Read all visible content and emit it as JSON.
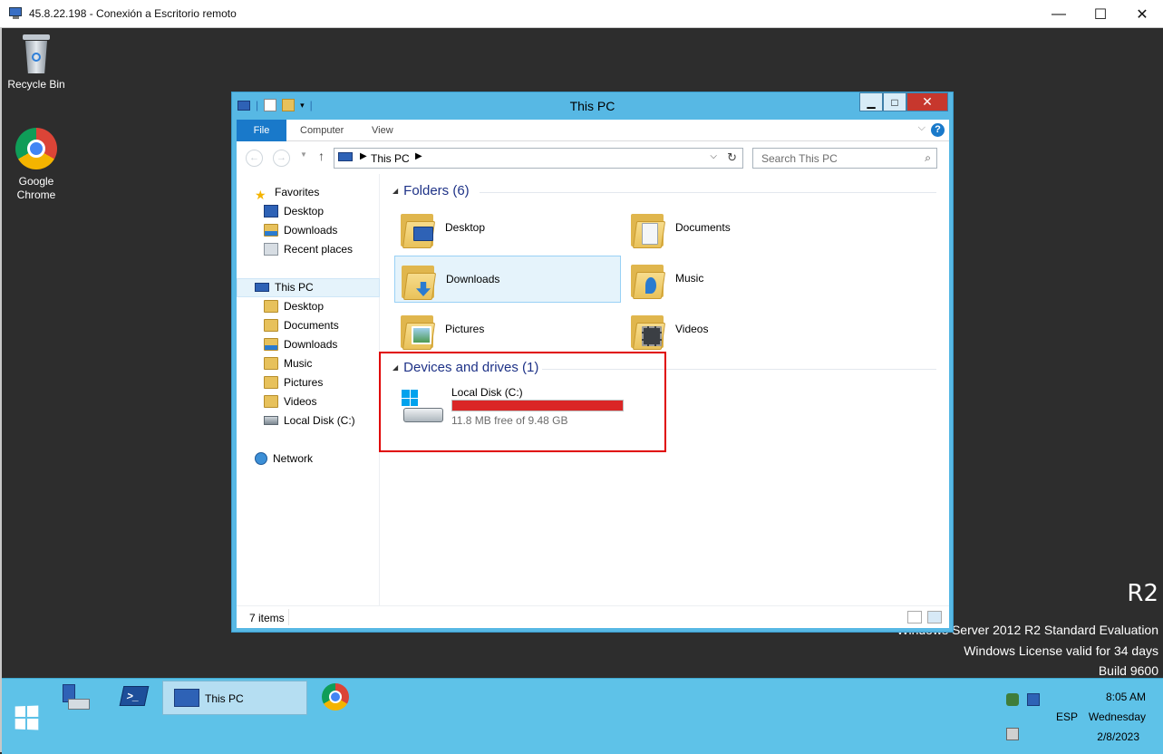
{
  "rdp": {
    "title": "45.8.22.198 - Conexión a Escritorio remoto",
    "minimize": "—",
    "maximize": "☐",
    "close": "✕"
  },
  "desktop": {
    "icons": [
      {
        "label": "Recycle Bin"
      },
      {
        "label": "Google Chrome"
      }
    ],
    "watermark": {
      "product": "R2",
      "edition": "Windows Server 2012 R2 Standard Evaluation",
      "license": "Windows License valid for 34 days",
      "build": "Build 9600"
    }
  },
  "explorer": {
    "title": "This PC",
    "ribbon": {
      "tabs": [
        "File",
        "Computer",
        "View"
      ],
      "help": "?"
    },
    "address": {
      "crumb": "This PC"
    },
    "search": {
      "placeholder": "Search This PC"
    },
    "nav": {
      "favorites": "Favorites",
      "fav_items": [
        "Desktop",
        "Downloads",
        "Recent places"
      ],
      "this_pc": "This PC",
      "pc_items": [
        "Desktop",
        "Documents",
        "Downloads",
        "Music",
        "Pictures",
        "Videos",
        "Local Disk (C:)"
      ],
      "network": "Network"
    },
    "folders_header": "Folders (6)",
    "folders": [
      "Desktop",
      "Documents",
      "Downloads",
      "Music",
      "Pictures",
      "Videos"
    ],
    "devices_header": "Devices and drives (1)",
    "drive": {
      "name": "Local Disk (C:)",
      "info": "11.8 MB free of 9.48 GB",
      "used_fraction": 0.999
    },
    "status": {
      "items": "7 items"
    }
  },
  "taskbar": {
    "active_window": "This PC",
    "tray": {
      "time": "8:05 AM",
      "day": "Wednesday",
      "date": "2/8/2023",
      "lang": "ESP"
    }
  },
  "colors": {
    "accent": "#1979ca",
    "taskbar": "#5ec2e8",
    "window_frame": "#57b8e4",
    "drive_bar": "#da2626",
    "highlight": "#e00000"
  }
}
